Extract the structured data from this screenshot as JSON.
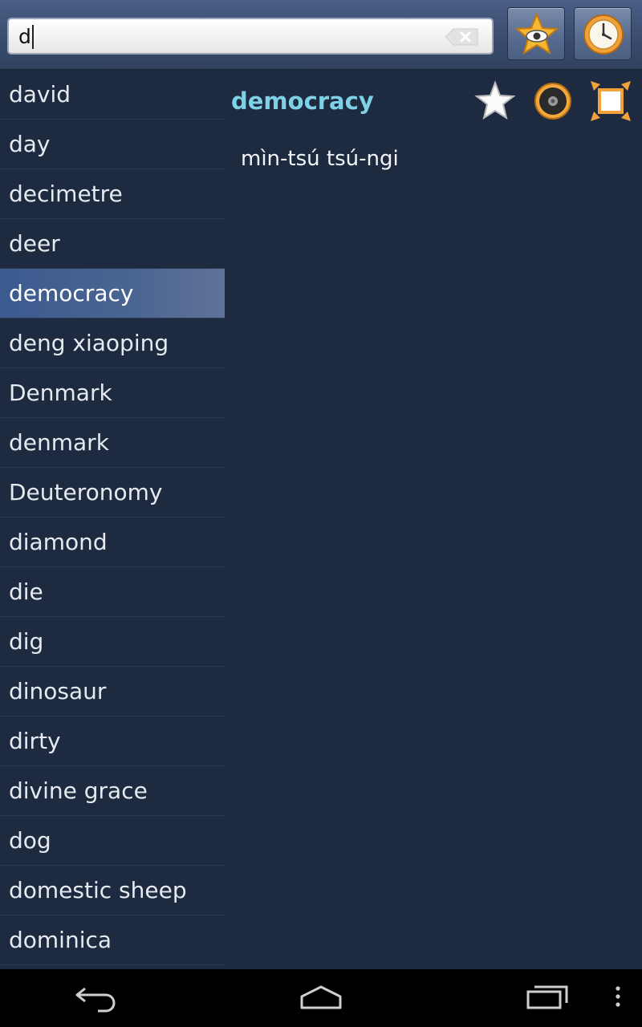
{
  "search": {
    "value": "d"
  },
  "words": [
    "david",
    "day",
    "decimetre",
    "deer",
    "democracy",
    "deng xiaoping",
    "Denmark",
    "denmark",
    "Deuteronomy",
    "diamond",
    "die",
    "dig",
    "dinosaur",
    "dirty",
    "divine grace",
    "dog",
    "domestic sheep",
    "dominica"
  ],
  "selected_index": 4,
  "detail": {
    "headword": "democracy",
    "translation": "mìn-tsú tsú-ngi"
  },
  "colors": {
    "background": "#1d2a40",
    "headword": "#7fd2e6",
    "selected_row": "#4b6592"
  },
  "icons": {
    "clear": "clear-text-icon",
    "favorites": "star-eye-icon",
    "history": "clock-icon",
    "add_favorite": "star-icon",
    "sound": "speaker-icon",
    "expand": "fullscreen-icon",
    "back": "back-icon",
    "home": "home-icon",
    "recents": "recents-icon",
    "menu": "overflow-menu-icon"
  }
}
